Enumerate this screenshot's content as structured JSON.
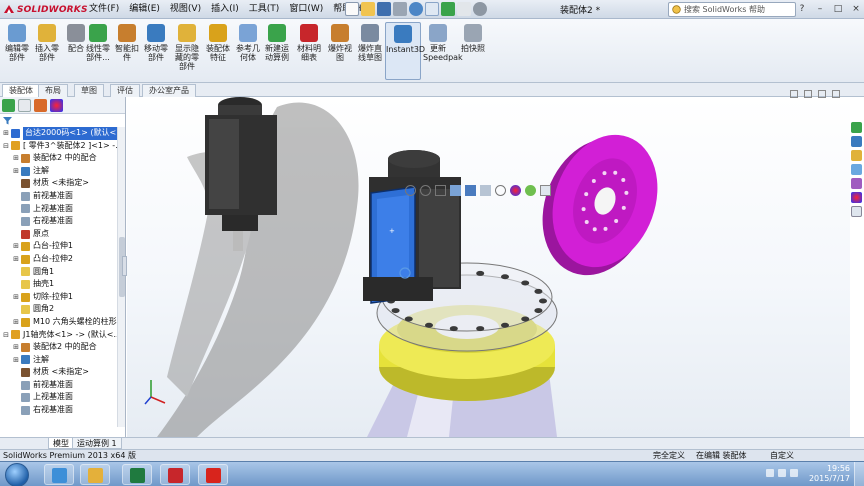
{
  "app": {
    "logo_text": "SOLIDWORKS",
    "document_title": "装配体2 *",
    "help_search_placeholder": "搜索 SolidWorks 帮助"
  },
  "menu": [
    "文件(F)",
    "编辑(E)",
    "视图(V)",
    "插入(I)",
    "工具(T)",
    "窗口(W)",
    "帮助(H)"
  ],
  "commands": [
    {
      "label": "编辑零部件",
      "icon": "edit-component-icon"
    },
    {
      "label": "插入零部件",
      "icon": "insert-components-icon"
    },
    {
      "label": "配合",
      "icon": "mate-icon"
    },
    {
      "label": "线性零部件...",
      "icon": "linear-pattern-icon"
    },
    {
      "label": "智能扣件",
      "icon": "smart-fasteners-icon"
    },
    {
      "label": "移动零部件",
      "icon": "move-component-icon"
    },
    {
      "label": "显示隐藏的零部件",
      "icon": "show-hidden-icon"
    },
    {
      "label": "装配体特征",
      "icon": "assembly-features-icon"
    },
    {
      "label": "参考几何体",
      "icon": "reference-geometry-icon"
    },
    {
      "label": "新建运动算例",
      "icon": "new-motion-study-icon"
    },
    {
      "label": "材料明细表",
      "icon": "bill-of-materials-icon"
    },
    {
      "label": "爆炸视图",
      "icon": "exploded-view-icon"
    },
    {
      "label": "爆炸直线草图",
      "icon": "explode-line-sketch-icon"
    },
    {
      "label": "Instant3D",
      "icon": "instant3d-icon"
    },
    {
      "label": "更新Speedpak",
      "icon": "speedpak-icon"
    },
    {
      "label": "拍快照",
      "icon": "snapshot-icon"
    }
  ],
  "tabs": [
    "装配体",
    "布局",
    "草图",
    "评估",
    "办公室产品"
  ],
  "tree": [
    {
      "label": "台达2000码<1> (默认<...",
      "level": 0,
      "expander": "+",
      "icon_color": "#2d6bd1",
      "selected": true
    },
    {
      "label": "[ 零件3^装配体2 ]<1> -...",
      "level": 0,
      "expander": "-",
      "icon_color": "#e0a020",
      "selected": false
    },
    {
      "label": "装配体2 中的配合",
      "level": 1,
      "expander": "+",
      "icon_color": "#c77e2e",
      "selected": false
    },
    {
      "label": "注解",
      "level": 1,
      "expander": "+",
      "icon_color": "#3a7bbf",
      "selected": false
    },
    {
      "label": "材质 <未指定>",
      "level": 1,
      "expander": "",
      "icon_color": "#7a5230",
      "selected": false
    },
    {
      "label": "前视基准面",
      "level": 1,
      "expander": "",
      "icon_color": "#8aa0b8",
      "selected": false
    },
    {
      "label": "上视基准面",
      "level": 1,
      "expander": "",
      "icon_color": "#8aa0b8",
      "selected": false
    },
    {
      "label": "右视基准面",
      "level": 1,
      "expander": "",
      "icon_color": "#8aa0b8",
      "selected": false
    },
    {
      "label": "原点",
      "level": 1,
      "expander": "",
      "icon_color": "#c0392b",
      "selected": false
    },
    {
      "label": "凸台-拉伸1",
      "level": 1,
      "expander": "+",
      "icon_color": "#d9a21b",
      "selected": false
    },
    {
      "label": "凸台-拉伸2",
      "level": 1,
      "expander": "+",
      "icon_color": "#d9a21b",
      "selected": false
    },
    {
      "label": "圆角1",
      "level": 1,
      "expander": "",
      "icon_color": "#e7c64a",
      "selected": false
    },
    {
      "label": "抽壳1",
      "level": 1,
      "expander": "",
      "icon_color": "#e7c64a",
      "selected": false
    },
    {
      "label": "切除-拉伸1",
      "level": 1,
      "expander": "+",
      "icon_color": "#d9a21b",
      "selected": false
    },
    {
      "label": "圆角2",
      "level": 1,
      "expander": "",
      "icon_color": "#e7c64a",
      "selected": false
    },
    {
      "label": "M10 六角头螺栓的柱形...",
      "level": 1,
      "expander": "+",
      "icon_color": "#d9a21b",
      "selected": false
    },
    {
      "label": "J1轴壳体<1> -> (默认<...",
      "level": 0,
      "expander": "-",
      "icon_color": "#e0a020",
      "selected": false
    },
    {
      "label": "装配体2 中的配合",
      "level": 1,
      "expander": "+",
      "icon_color": "#c77e2e",
      "selected": false
    },
    {
      "label": "注解",
      "level": 1,
      "expander": "+",
      "icon_color": "#3a7bbf",
      "selected": false
    },
    {
      "label": "材质 <未指定>",
      "level": 1,
      "expander": "",
      "icon_color": "#7a5230",
      "selected": false
    },
    {
      "label": "前视基准面",
      "level": 1,
      "expander": "",
      "icon_color": "#8aa0b8",
      "selected": false
    },
    {
      "label": "上视基准面",
      "level": 1,
      "expander": "",
      "icon_color": "#8aa0b8",
      "selected": false
    },
    {
      "label": "右视基准面",
      "level": 1,
      "expander": "",
      "icon_color": "#8aa0b8",
      "selected": false
    }
  ],
  "bottom_tabs": [
    "模型",
    "运动算例 1"
  ],
  "status": {
    "left": "SolidWorks Premium 2013 x64 版",
    "underdefined": "完全定义",
    "mode": "在编辑 装配体",
    "units": "自定义"
  },
  "taskbar": {
    "apps": [
      {
        "name": "start-ie",
        "icon": "ie-icon",
        "color": "#3d8fd8"
      },
      {
        "name": "explorer",
        "icon": "explorer-icon",
        "color": "#e4b03a"
      },
      {
        "name": "excel",
        "icon": "excel-icon",
        "color": "#1f7a3f"
      },
      {
        "name": "acrobat",
        "icon": "acrobat-icon",
        "color": "#c7262b"
      },
      {
        "name": "solidworks",
        "icon": "solidworks-icon",
        "color": "#d8241c"
      }
    ],
    "time": "19:56",
    "date": "2015/7/17"
  },
  "colors": {
    "motor_body": "#2f2f2f",
    "motor_highlight": "#2e6fd6",
    "reducer_magenta": "#d21fd6",
    "bearing_yellow": "#e6e23a",
    "housing_lavender": "#c9c8e6",
    "selection_blue": "#2d6bd1"
  }
}
